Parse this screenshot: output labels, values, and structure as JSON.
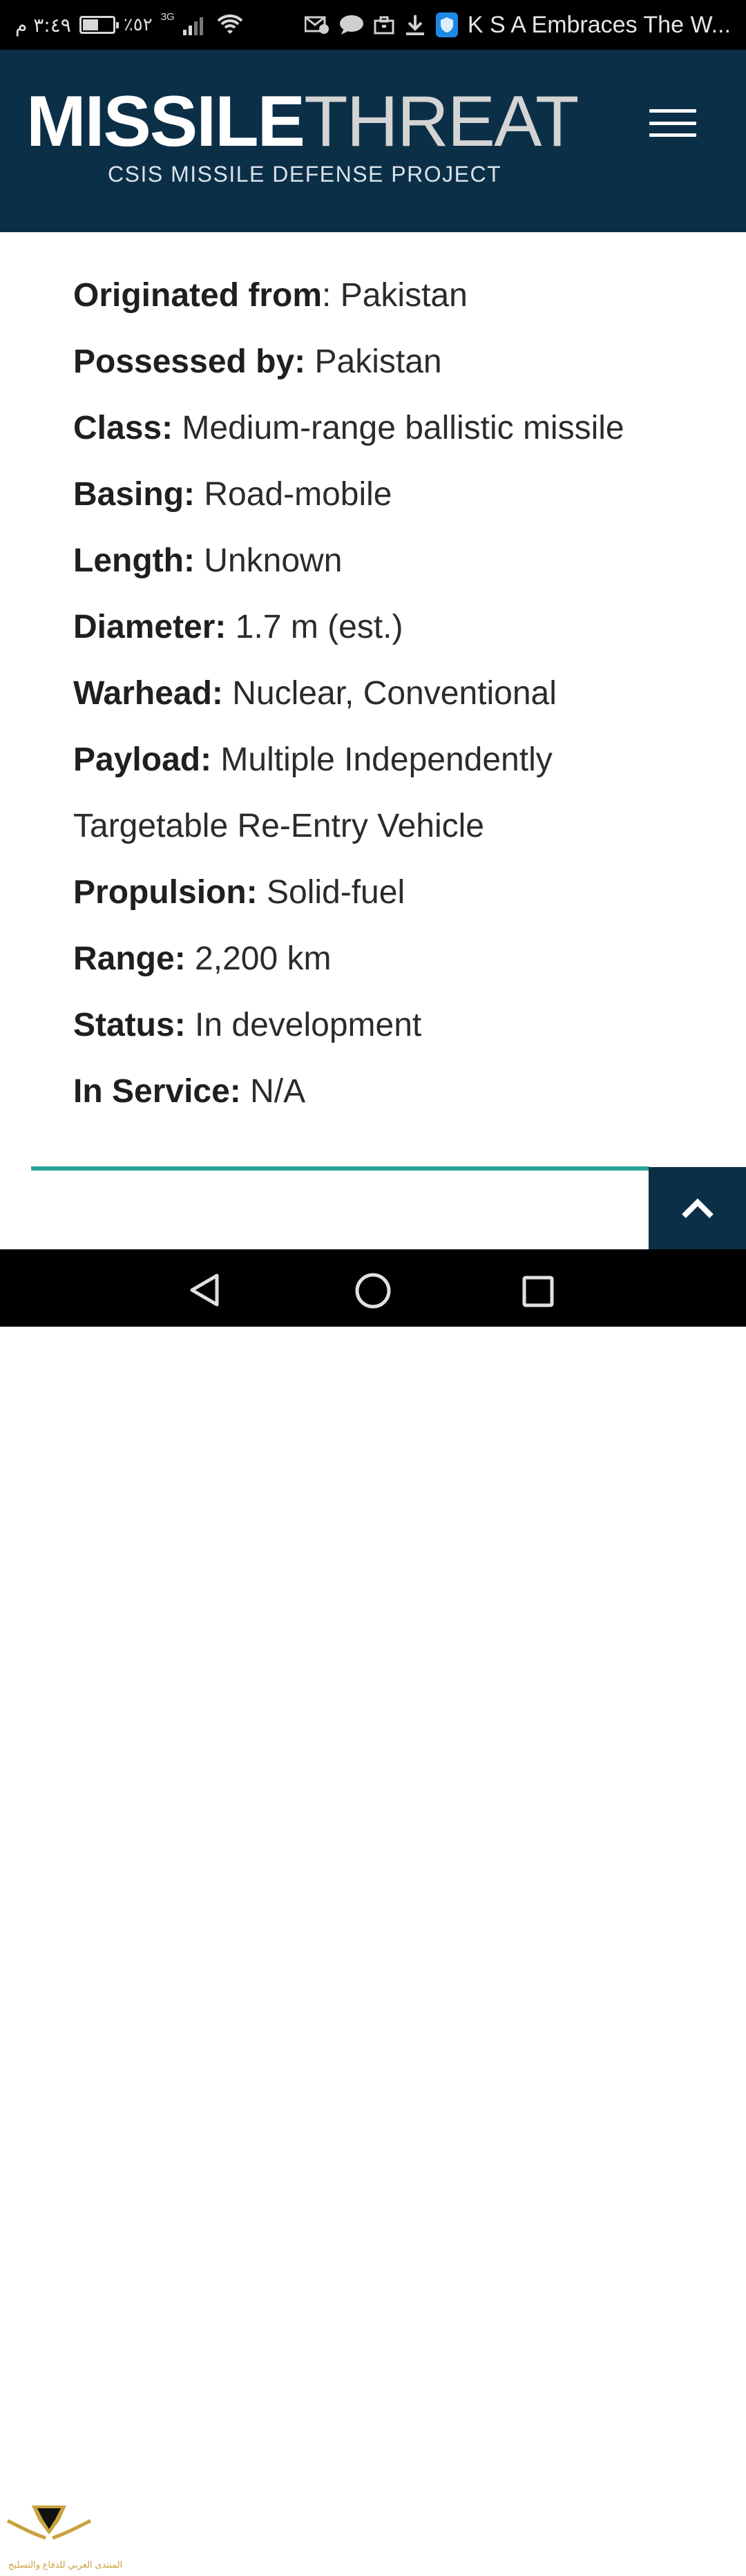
{
  "status_bar": {
    "time": "٣:٤٩ م",
    "battery_percent_text": "٪٥٢",
    "battery_level": 0.52,
    "network_type": "3G",
    "notification_title": "K S A Embraces The W..."
  },
  "header": {
    "logo_bold": "MISSILE",
    "logo_light": "THREAT",
    "tagline": "CSIS MISSILE DEFENSE PROJECT"
  },
  "specs": [
    {
      "label": "Originated from",
      "sep": ": ",
      "value": "Pakistan"
    },
    {
      "label": "Possessed by:",
      "sep": " ",
      "value": "Pakistan"
    },
    {
      "label": "Class:",
      "sep": " ",
      "value": "Medium-range ballistic missile"
    },
    {
      "label": "Basing:",
      "sep": " ",
      "value": "Road-mobile"
    },
    {
      "label": "Length:",
      "sep": " ",
      "value": "Unknown"
    },
    {
      "label": "Diameter:",
      "sep": " ",
      "value": "1.7 m (est.)"
    },
    {
      "label": "Warhead:",
      "sep": " ",
      "value": "Nuclear, Conventional"
    },
    {
      "label": "Payload:",
      "sep": " ",
      "value": "Multiple Independently Targetable Re-Entry Vehicle"
    },
    {
      "label": "Propulsion:",
      "sep": " ",
      "value": "Solid-fuel"
    },
    {
      "label": "Range:",
      "sep": " ",
      "value": "2,200 km"
    },
    {
      "label": "Status:",
      "sep": " ",
      "value": "In development"
    },
    {
      "label": "In Service:",
      "sep": " ",
      "value": "N/A"
    }
  ],
  "watermark": {
    "text": "المنتدى العربي للدفاع والتسليح"
  },
  "icons": {
    "menu": "hamburger-menu-icon",
    "back_to_top": "chevron-up-icon",
    "nav_back": "triangle-back-icon",
    "nav_home": "circle-home-icon",
    "nav_recent": "square-recents-icon"
  },
  "colors": {
    "header_bg": "#0b2f46",
    "accent_line": "#28a19a",
    "body_text": "#2b2b2b"
  }
}
